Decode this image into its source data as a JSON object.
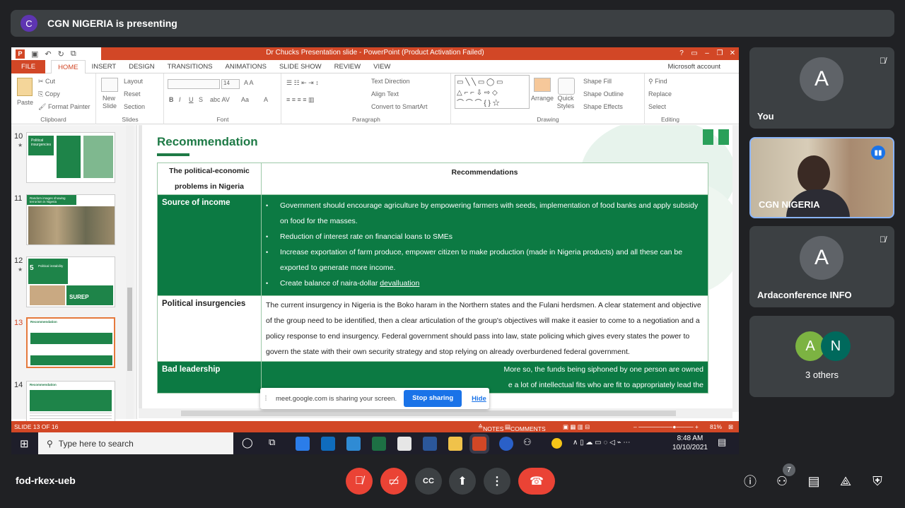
{
  "meet": {
    "presenting_avatar": "C",
    "presenting_text": "CGN NIGERIA is presenting",
    "meeting_code": "fod-rkex-ueb",
    "people_count": "7",
    "participants": [
      {
        "initial": "A",
        "name": "You",
        "muted": true
      },
      {
        "initial": "",
        "name": "CGN NIGERIA",
        "speaking": true
      },
      {
        "initial": "A",
        "name": "Ardaconference INFO",
        "muted": true
      }
    ],
    "others": {
      "initials": [
        "A",
        "N"
      ],
      "label": "3 others"
    },
    "colors": {
      "background": "#202124",
      "tile": "#3c4043",
      "end_call": "#ea4335",
      "avatar_a": "#7cb342",
      "avatar_n": "#00695c"
    }
  },
  "powerpoint": {
    "window_title": "Dr Chucks Presentation slide - PowerPoint (Product Activation Failed)",
    "menu": [
      "FILE",
      "HOME",
      "INSERT",
      "DESIGN",
      "TRANSITIONS",
      "ANIMATIONS",
      "SLIDE SHOW",
      "REVIEW",
      "VIEW"
    ],
    "account": "Microsoft account",
    "ribbon": {
      "clipboard": {
        "paste": "Paste",
        "cut": "Cut",
        "copy": "Copy",
        "format_painter": "Format Painter",
        "label": "Clipboard"
      },
      "slides": {
        "new_slide": "New Slide",
        "layout": "Layout",
        "reset": "Reset",
        "section": "Section",
        "label": "Slides"
      },
      "font": {
        "size": "14",
        "label": "Font"
      },
      "paragraph": {
        "text_direction": "Text Direction",
        "align_text": "Align Text",
        "convert": "Convert to SmartArt",
        "label": "Paragraph"
      },
      "drawing": {
        "arrange": "Arrange",
        "quick_styles": "Quick Styles",
        "shape_fill": "Shape Fill",
        "shape_outline": "Shape Outline",
        "shape_effects": "Shape Effects",
        "label": "Drawing"
      },
      "editing": {
        "find": "Find",
        "replace": "Replace",
        "select": "Select",
        "label": "Editing"
      }
    },
    "thumbnails": [
      {
        "num": "10",
        "title": "Political insurgencies"
      },
      {
        "num": "11",
        "title": "Random images showing terrorism in Nigeria"
      },
      {
        "num": "12",
        "title": "Political instability",
        "big_num": "5",
        "banner": "SUREP"
      },
      {
        "num": "13",
        "title": "Recommendation",
        "selected": true
      },
      {
        "num": "14",
        "title": "Recommendation"
      }
    ],
    "slide": {
      "title": "Recommendation",
      "header_col1": "The political-economic problems in Nigeria",
      "header_col2": "Recommendations",
      "rows": [
        {
          "heading": "Source of income",
          "bullets": [
            "Government should encourage agriculture by empowering farmers with seeds, implementation of food banks and apply subsidy on food for the masses.",
            "Reduction of interest rate on financial loans to SMEs",
            "Increase exportation of farm produce, empower citizen to make production (made in Nigeria products) and all these can be exported to generate more income.",
            "Create balance of naira-dollar"
          ],
          "underlined_word": "devalluation"
        },
        {
          "heading": "Political insurgencies",
          "text": "The current insurgency in Nigeria is the Boko haram in the Northern states and the Fulani herdsmen. A clear statement and objective of the group need to be identified, then a clear articulation of the group's objectives will make it easier to come to a negotiation and a policy response to end insurgency. Federal government should pass into law, state policing which gives every states the power to govern the state with their own security strategy and stop relying on already overburdened federal government."
        },
        {
          "heading": "Bad leadership",
          "text_line1": "More so, the funds being siphoned by one person are owned",
          "text_line2": "e a lot of intellectual fits who are fit to appropriately lead the"
        }
      ]
    },
    "share_bar": {
      "text": "meet.google.com is sharing your screen.",
      "stop": "Stop sharing",
      "hide": "Hide"
    },
    "status": {
      "slide": "SLIDE 13 OF 16",
      "notes": "NOTES",
      "comments": "COMMENTS",
      "zoom": "81%"
    },
    "taskbar": {
      "search": "Type here to search",
      "time": "8:48 AM",
      "date": "10/10/2021"
    }
  }
}
